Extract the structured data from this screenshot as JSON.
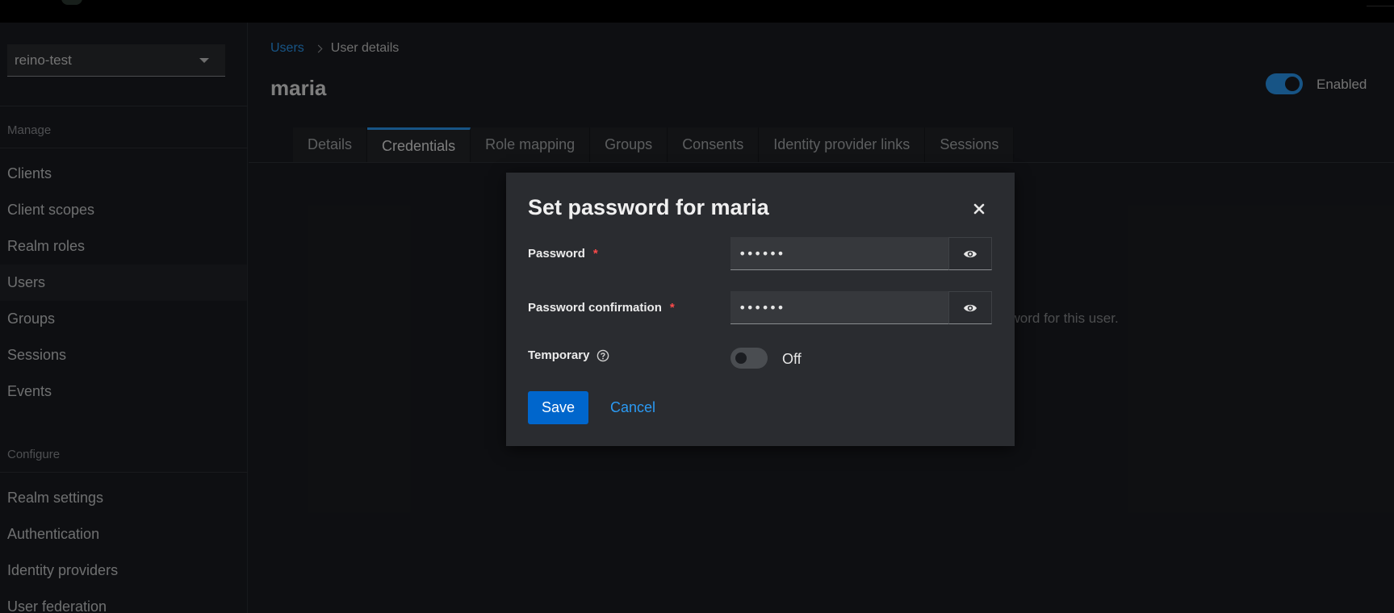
{
  "sidebar": {
    "realm": "reino-test",
    "manage_heading": "Manage",
    "manage_items": [
      {
        "label": "Clients"
      },
      {
        "label": "Client scopes"
      },
      {
        "label": "Realm roles"
      },
      {
        "label": "Users",
        "active": true
      },
      {
        "label": "Groups"
      },
      {
        "label": "Sessions"
      },
      {
        "label": "Events"
      }
    ],
    "configure_heading": "Configure",
    "configure_items": [
      {
        "label": "Realm settings"
      },
      {
        "label": "Authentication"
      },
      {
        "label": "Identity providers"
      },
      {
        "label": "User federation"
      }
    ]
  },
  "breadcrumb": {
    "parent": "Users",
    "current": "User details"
  },
  "page": {
    "title": "maria",
    "enabled_label": "Enabled",
    "enabled": true,
    "background_text": "sword for this user."
  },
  "tabs": [
    {
      "label": "Details"
    },
    {
      "label": "Credentials",
      "active": true
    },
    {
      "label": "Role mapping"
    },
    {
      "label": "Groups"
    },
    {
      "label": "Consents"
    },
    {
      "label": "Identity provider links"
    },
    {
      "label": "Sessions"
    }
  ],
  "modal": {
    "title": "Set password for maria",
    "password_label": "Password",
    "password_value": "••••••",
    "confirm_label": "Password confirmation",
    "confirm_value": "••••••",
    "required_marker": "*",
    "temporary_label": "Temporary",
    "temporary_state": "Off",
    "save_label": "Save",
    "cancel_label": "Cancel"
  },
  "colors": {
    "accent": "#2b9af3",
    "primary_button": "#0066cc",
    "required": "#ff4a4a",
    "background": "#1b1d21",
    "modal": "#2a2c30"
  }
}
